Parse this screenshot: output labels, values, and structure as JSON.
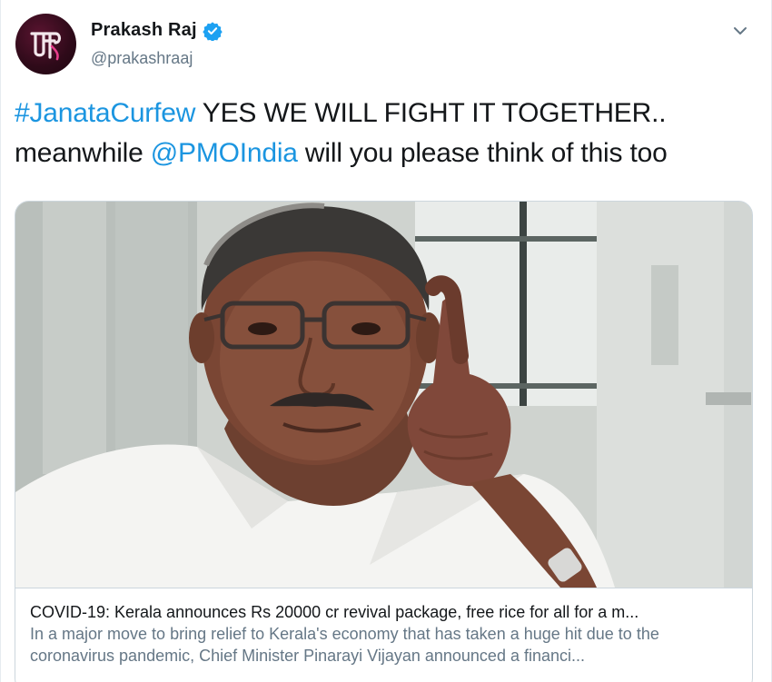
{
  "author": {
    "name": "Prakash Raj",
    "handle": "@prakashraaj",
    "avatar_letters": "ಪ್ರ",
    "verified": true
  },
  "tweet": {
    "hashtag": "#JanataCurfew",
    "text_part1": " YES WE WILL FIGHT IT TOGETHER..",
    "text_part2": "meanwhile ",
    "mention": "@PMOIndia",
    "text_part3": " will you please think of this too"
  },
  "card": {
    "image_alt": "Man with glasses raising a finger",
    "title": "COVID-19: Kerala announces Rs 20000 cr revival package, free rice for all for a m...",
    "description": "In a major move to bring relief to Kerala's economy that has taken a huge hit due to the coronavirus pandemic, Chief Minister Pinarayi Vijayan announced a financi..."
  },
  "icons": {
    "verified": "verified-badge-icon",
    "more": "chevron-down-icon"
  },
  "colors": {
    "link": "#1b95e0",
    "verified": "#1da1f2",
    "handle": "#657786",
    "avatar_bg": "#2e0a19",
    "avatar_accent": "#e83e8c"
  }
}
